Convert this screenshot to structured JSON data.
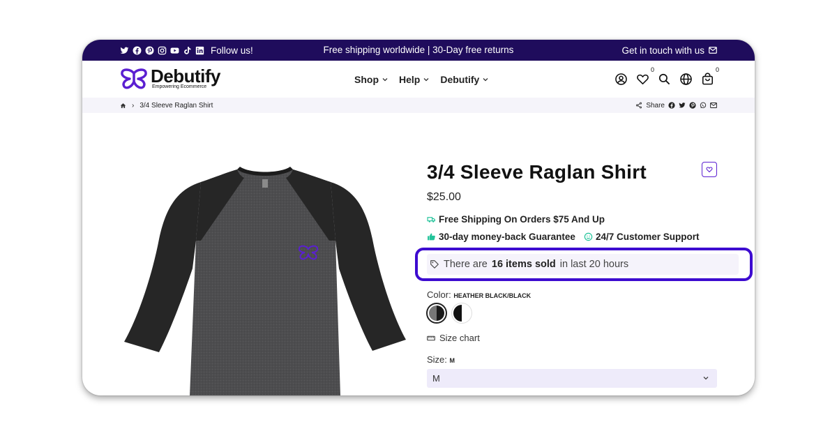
{
  "topbar": {
    "follow_label": "Follow us!",
    "announcement": "Free shipping worldwide | 30-Day free returns",
    "contact_label": "Get in touch with us",
    "social_icons": [
      "twitter-icon",
      "facebook-icon",
      "pinterest-icon",
      "instagram-icon",
      "youtube-icon",
      "tiktok-icon",
      "linkedin-icon"
    ]
  },
  "header": {
    "logo_name": "Debutify",
    "logo_tagline": "Empowering Ecommerce",
    "nav": [
      {
        "label": "Shop"
      },
      {
        "label": "Help"
      },
      {
        "label": "Debutify"
      }
    ],
    "wishlist_count": "0",
    "cart_count": "0"
  },
  "breadcrumb": {
    "current": "3/4 Sleeve Raglan Shirt",
    "share_label": "Share"
  },
  "product": {
    "title": "3/4 Sleeve Raglan Shirt",
    "price": "$25.00",
    "perks": {
      "shipping": "Free Shipping On Orders $75 And Up",
      "guarantee": "30-day money-back Guarantee",
      "support": "24/7 Customer Support"
    },
    "sold": {
      "prefix": "There are",
      "count_text": "16 items sold",
      "suffix": "in last 20 hours"
    },
    "color_label": "Color:",
    "color_value": "HEATHER BLACK/BLACK",
    "size_chart_label": "Size chart",
    "size_label": "Size:",
    "size_value": "M",
    "size_selected": "M"
  },
  "colors": {
    "topbar_bg": "#1f0c5c",
    "accent": "#3d0bd0",
    "perk_icon": "#22c39a",
    "crumb_bg": "#f5f4fa",
    "select_bg": "#eeebfa"
  }
}
